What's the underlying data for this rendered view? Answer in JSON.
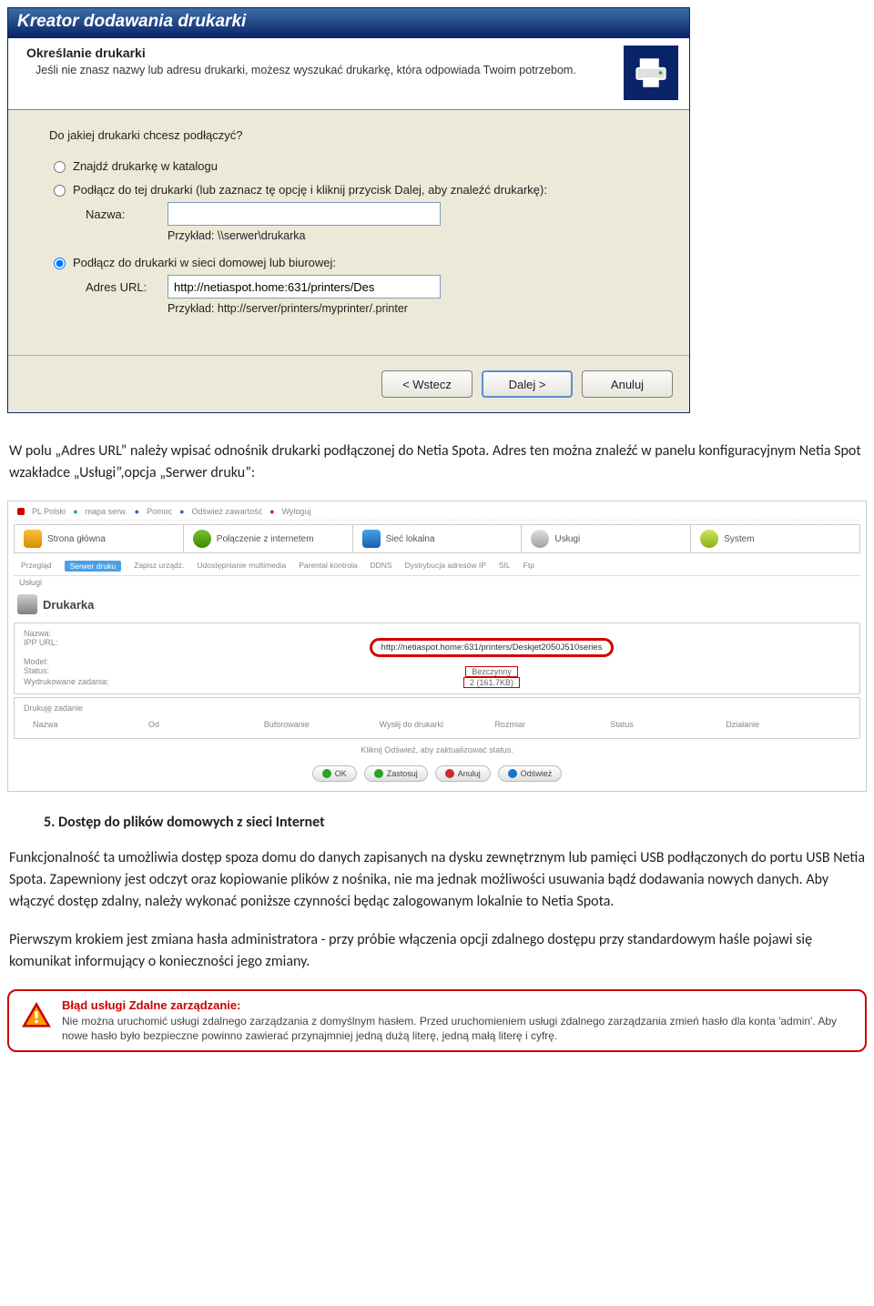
{
  "wizard": {
    "titlebar": "Kreator dodawania drukarki",
    "header_title": "Określanie drukarki",
    "header_desc": "Jeśli nie znasz nazwy lub adresu drukarki, możesz wyszukać drukarkę, która odpowiada Twoim potrzebom.",
    "question": "Do jakiej drukarki chcesz podłączyć?",
    "radio1": "Znajdź drukarkę w katalogu",
    "radio2": "Podłącz do tej drukarki (lub zaznacz tę opcję i kliknij przycisk Dalej, aby znaleźć drukarkę):",
    "name_label": "Nazwa:",
    "name_value": "",
    "name_example": "Przykład: \\\\serwer\\drukarka",
    "radio3": "Podłącz do drukarki w sieci domowej lub biurowej:",
    "url_label": "Adres URL:",
    "url_value": "http://netiaspot.home:631/printers/Des",
    "url_example": "Przykład: http://server/printers/myprinter/.printer",
    "btn_back": "< Wstecz",
    "btn_next": "Dalej >",
    "btn_cancel": "Anuluj"
  },
  "doc": {
    "p1": "W polu „Adres URL” należy wpisać odnośnik drukarki podłączonej do Netia Spota. Adres ten można znaleźć w panelu konfiguracyjnym Netia Spot wzakładce „Usługi”,opcja „Serwer druku”:",
    "heading5": "5.  Dostęp do plików domowych z sieci Internet",
    "p2": "Funkcjonalność ta umożliwia dostęp spoza domu do danych zapisanych na dysku zewnętrznym lub pamięci USB podłączonych do portu USB Netia Spota. Zapewniony jest odczyt oraz kopiowanie plików z nośnika, nie ma jednak możliwości usuwania bądź dodawania nowych danych. Aby włączyć dostęp zdalny, należy wykonać poniższe czynności będąc zalogowanym lokalnie to Netia Spota.",
    "p3": "Pierwszym krokiem jest zmiana hasła administratora - przy próbie włączenia opcji zdalnego dostępu przy standardowym haśle pojawi się komunikat informujący o konieczności jego zmiany."
  },
  "spot": {
    "breadcrumb": [
      "PL Polski",
      "mapa serw.",
      "Pomoc",
      "Odśwież zawartość",
      "Wyloguj"
    ],
    "tabs": {
      "home": "Strona główna",
      "net": "Połączenie z internetem",
      "local": "Sieć lokalna",
      "serv": "Usługi",
      "sys": "System"
    },
    "subtabs": [
      "Przegląd",
      "Serwer druku",
      "Zapisz urządz.",
      "Udostępnianie multimedia",
      "Parental kontrola",
      "DDNS",
      "Dystrybucja adresów IP",
      "SIL",
      "Ftp"
    ],
    "section_title_services": "Usługi",
    "section_title_printer": "Drukarka",
    "fields": {
      "name": "Nazwa:",
      "ipp": "IPP URL:",
      "model": "Model:",
      "status": "Status:",
      "jobs": "Wydrukowane zadania:"
    },
    "ipp_value": "http://netiaspot.home:631/printers/Deskjet2050J510series",
    "status_value": "Bezczynny",
    "jobs_value": "2 (161.7KB)",
    "pending_title": "Drukuję zadanie",
    "cols": [
      "Nazwa",
      "Od",
      "Buforowanie",
      "Wysłij do drukarki",
      "Rozmiar",
      "Status",
      "Działanie"
    ],
    "refresh_note": "Kliknij Odśwież, aby zaktualizować status.",
    "btn_ok": "OK",
    "btn_apply": "Zastosuj",
    "btn_cancel": "Anuluj",
    "btn_refresh": "Odśwież"
  },
  "error": {
    "title": "Błąd usługi Zdalne zarządzanie:",
    "text": "Nie można uruchomić usługi zdalnego zarządzania z domyślnym hasłem. Przed uruchomieniem usługi zdalnego zarządzania zmień hasło dla konta 'admin'. Aby nowe hasło było bezpieczne powinno zawierać przynajmniej jedną dużą literę, jedną małą literę i cyfrę."
  }
}
